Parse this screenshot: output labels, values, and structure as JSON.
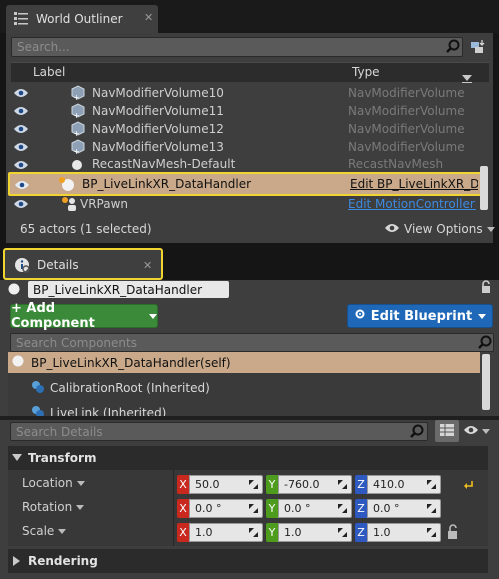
{
  "outliner": {
    "tab_title": "World Outliner",
    "search_placeholder": "Search...",
    "col_label": "Label",
    "col_type": "Type",
    "rows": [
      {
        "label": "NavModifierVolume10",
        "type": "NavModifierVolume"
      },
      {
        "label": "NavModifierVolume11",
        "type": "NavModifierVolume"
      },
      {
        "label": "NavModifierVolume12",
        "type": "NavModifierVolume"
      },
      {
        "label": "NavModifierVolume13",
        "type": "NavModifierVolume"
      },
      {
        "label": "RecastNavMesh-Default",
        "type": "RecastNavMesh"
      },
      {
        "label": "BP_LiveLinkXR_DataHandler",
        "type": "Edit BP_LiveLinkXR_D"
      },
      {
        "label": "VRPawn",
        "type": "Edit MotionControllerF"
      }
    ],
    "status": "65 actors (1 selected)",
    "view_options": "View Options"
  },
  "details": {
    "tab_title": "Details",
    "actor_name": "BP_LiveLinkXR_DataHandler",
    "add_component": "+ Add Component",
    "edit_blueprint": "Edit Blueprint",
    "search_components_placeholder": "Search Components",
    "components": [
      {
        "label": "BP_LiveLinkXR_DataHandler(self)"
      },
      {
        "label": "CalibrationRoot (Inherited)"
      },
      {
        "label": "LiveLink (Inherited)"
      }
    ],
    "search_details_placeholder": "Search Details",
    "transform_title": "Transform",
    "location_label": "Location",
    "rotation_label": "Rotation",
    "scale_label": "Scale",
    "location": {
      "x": "50.0",
      "y": "-760.0",
      "z": "410.0"
    },
    "rotation": {
      "x": "0.0 °",
      "y": "0.0 °",
      "z": "0.0 °"
    },
    "scale": {
      "x": "1.0",
      "y": "1.0",
      "z": "1.0"
    },
    "rendering_title": "Rendering",
    "axis_x": "X",
    "axis_y": "Y",
    "axis_z": "Z"
  },
  "colors": {
    "selection": "#c9a98a",
    "highlight": "#f0d431",
    "add_green": "#3a8a3a",
    "edit_blue": "#1f68b8"
  }
}
